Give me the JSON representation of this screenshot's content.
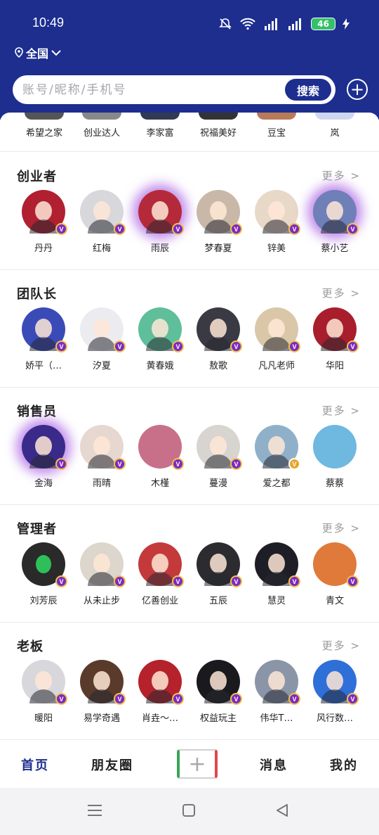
{
  "status_bar": {
    "time": "10:49",
    "battery": "46"
  },
  "header": {
    "region": "全国",
    "search_placeholder": "账号/昵称/手机号",
    "search_button": "搜索"
  },
  "partial_row": [
    "希望之家",
    "创业达人",
    "李家富",
    "祝福美好",
    "豆宝",
    "岚"
  ],
  "more_label": "更多 >",
  "sections": [
    {
      "title": "创业者",
      "members": [
        "丹丹",
        "红梅",
        "雨辰",
        "梦春夏",
        "锌美",
        "蔡小艺"
      ]
    },
    {
      "title": "团队长",
      "members": [
        "娇平（…",
        "汐夏",
        "黄春娥",
        "敖歌",
        "凡凡老师",
        "华阳"
      ]
    },
    {
      "title": "销售员",
      "members": [
        "金海",
        "雨晴",
        "木槿",
        "蔓漫",
        "爱之都",
        "蔡蔡"
      ]
    },
    {
      "title": "管理者",
      "members": [
        "刘芳辰",
        "从未止步",
        "亿善创业",
        "五辰",
        "慧灵",
        "青文"
      ]
    },
    {
      "title": "老板",
      "members": [
        "暖阳",
        "易学奇遇",
        "肖垚～…",
        "权益玩主",
        "伟华T…",
        "风行数…"
      ]
    }
  ],
  "tabs": {
    "home": "首页",
    "moments": "朋友圈",
    "messages": "消息",
    "mine": "我的"
  },
  "colors": {
    "brand": "#1d2e8f",
    "badge": "#7b2bbf"
  }
}
